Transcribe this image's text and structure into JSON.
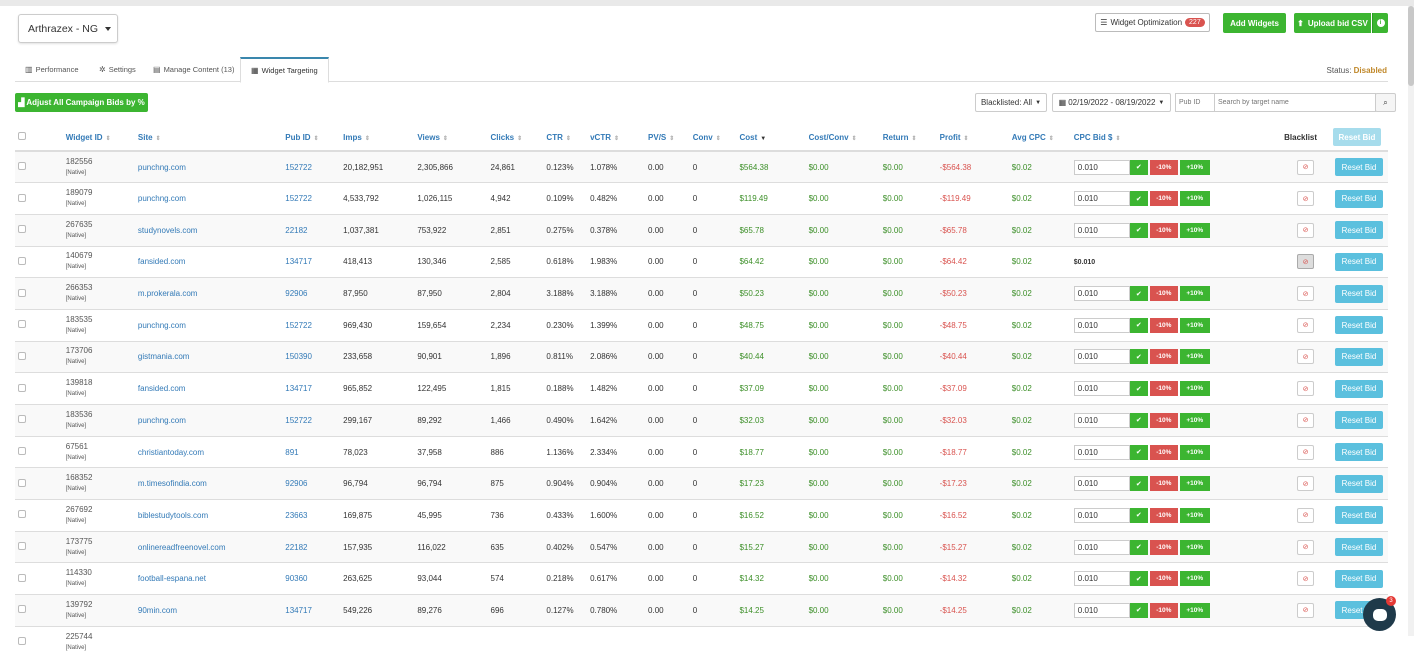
{
  "account": {
    "name": "Arthrazex - NG"
  },
  "toolbar": {
    "widget_optimization_label": "Widget Optimization",
    "widget_optimization_count": "227",
    "add_widgets_label": "Add Widgets",
    "upload_bid_csv_label": "Upload bid CSV"
  },
  "tabs": [
    {
      "label": "Performance",
      "icon": "bar-chart-icon"
    },
    {
      "label": "Settings",
      "icon": "gear-icon"
    },
    {
      "label": "Manage Content (13)",
      "icon": "file-icon"
    },
    {
      "label": "Widget Targeting",
      "icon": "grid-icon"
    }
  ],
  "status": {
    "label": "Status:",
    "value": "Disabled"
  },
  "filters": {
    "adjust_label": "Adjust All Campaign Bids by %",
    "blacklisted_label": "Blacklisted: All",
    "date_range": "02/19/2022 - 08/19/2022",
    "pub_id_placeholder": "Pub ID",
    "search_placeholder": "Search by target name"
  },
  "table": {
    "headers": [
      "Widget ID",
      "Site",
      "Pub ID",
      "Imps",
      "Views",
      "Clicks",
      "CTR",
      "vCTR",
      "PV/S",
      "Conv",
      "Cost",
      "Cost/Conv",
      "Return",
      "Profit",
      "Avg CPC",
      "CPC Bid $",
      "Blacklist"
    ],
    "reset_header_label": "Reset Bid",
    "native_tag": "[Native]",
    "minus_label": "-10%",
    "plus_label": "+10%",
    "reset_label": "Reset Bid",
    "rows": [
      {
        "wid": "182556",
        "site": "punchng.com",
        "pub": "152722",
        "imps": "20,182,951",
        "views": "2,305,866",
        "clicks": "24,861",
        "ctr": "0.123%",
        "vctr": "1.078%",
        "pvs": "0.00",
        "conv": "0",
        "cost": "$564.38",
        "cpc_conv": "$0.00",
        "ret": "$0.00",
        "profit": "-$564.38",
        "avg": "$0.02",
        "bid": "0.010",
        "fixed": false
      },
      {
        "wid": "189079",
        "site": "punchng.com",
        "pub": "152722",
        "imps": "4,533,792",
        "views": "1,026,115",
        "clicks": "4,942",
        "ctr": "0.109%",
        "vctr": "0.482%",
        "pvs": "0.00",
        "conv": "0",
        "cost": "$119.49",
        "cpc_conv": "$0.00",
        "ret": "$0.00",
        "profit": "-$119.49",
        "avg": "$0.02",
        "bid": "0.010",
        "fixed": false
      },
      {
        "wid": "267635",
        "site": "studynovels.com",
        "pub": "22182",
        "imps": "1,037,381",
        "views": "753,922",
        "clicks": "2,851",
        "ctr": "0.275%",
        "vctr": "0.378%",
        "pvs": "0.00",
        "conv": "0",
        "cost": "$65.78",
        "cpc_conv": "$0.00",
        "ret": "$0.00",
        "profit": "-$65.78",
        "avg": "$0.02",
        "bid": "0.010",
        "fixed": false
      },
      {
        "wid": "140679",
        "site": "fansided.com",
        "pub": "134717",
        "imps": "418,413",
        "views": "130,346",
        "clicks": "2,585",
        "ctr": "0.618%",
        "vctr": "1.983%",
        "pvs": "0.00",
        "conv": "0",
        "cost": "$64.42",
        "cpc_conv": "$0.00",
        "ret": "$0.00",
        "profit": "-$64.42",
        "avg": "$0.02",
        "bid": "$0.010",
        "fixed": true
      },
      {
        "wid": "266353",
        "site": "m.prokerala.com",
        "pub": "92906",
        "imps": "87,950",
        "views": "87,950",
        "clicks": "2,804",
        "ctr": "3.188%",
        "vctr": "3.188%",
        "pvs": "0.00",
        "conv": "0",
        "cost": "$50.23",
        "cpc_conv": "$0.00",
        "ret": "$0.00",
        "profit": "-$50.23",
        "avg": "$0.02",
        "bid": "0.010",
        "fixed": false
      },
      {
        "wid": "183535",
        "site": "punchng.com",
        "pub": "152722",
        "imps": "969,430",
        "views": "159,654",
        "clicks": "2,234",
        "ctr": "0.230%",
        "vctr": "1.399%",
        "pvs": "0.00",
        "conv": "0",
        "cost": "$48.75",
        "cpc_conv": "$0.00",
        "ret": "$0.00",
        "profit": "-$48.75",
        "avg": "$0.02",
        "bid": "0.010",
        "fixed": false
      },
      {
        "wid": "173706",
        "site": "gistmania.com",
        "pub": "150390",
        "imps": "233,658",
        "views": "90,901",
        "clicks": "1,896",
        "ctr": "0.811%",
        "vctr": "2.086%",
        "pvs": "0.00",
        "conv": "0",
        "cost": "$40.44",
        "cpc_conv": "$0.00",
        "ret": "$0.00",
        "profit": "-$40.44",
        "avg": "$0.02",
        "bid": "0.010",
        "fixed": false
      },
      {
        "wid": "139818",
        "site": "fansided.com",
        "pub": "134717",
        "imps": "965,852",
        "views": "122,495",
        "clicks": "1,815",
        "ctr": "0.188%",
        "vctr": "1.482%",
        "pvs": "0.00",
        "conv": "0",
        "cost": "$37.09",
        "cpc_conv": "$0.00",
        "ret": "$0.00",
        "profit": "-$37.09",
        "avg": "$0.02",
        "bid": "0.010",
        "fixed": false
      },
      {
        "wid": "183536",
        "site": "punchng.com",
        "pub": "152722",
        "imps": "299,167",
        "views": "89,292",
        "clicks": "1,466",
        "ctr": "0.490%",
        "vctr": "1.642%",
        "pvs": "0.00",
        "conv": "0",
        "cost": "$32.03",
        "cpc_conv": "$0.00",
        "ret": "$0.00",
        "profit": "-$32.03",
        "avg": "$0.02",
        "bid": "0.010",
        "fixed": false
      },
      {
        "wid": "67561",
        "site": "christiantoday.com",
        "pub": "891",
        "imps": "78,023",
        "views": "37,958",
        "clicks": "886",
        "ctr": "1.136%",
        "vctr": "2.334%",
        "pvs": "0.00",
        "conv": "0",
        "cost": "$18.77",
        "cpc_conv": "$0.00",
        "ret": "$0.00",
        "profit": "-$18.77",
        "avg": "$0.02",
        "bid": "0.010",
        "fixed": false
      },
      {
        "wid": "168352",
        "site": "m.timesofindia.com",
        "pub": "92906",
        "imps": "96,794",
        "views": "96,794",
        "clicks": "875",
        "ctr": "0.904%",
        "vctr": "0.904%",
        "pvs": "0.00",
        "conv": "0",
        "cost": "$17.23",
        "cpc_conv": "$0.00",
        "ret": "$0.00",
        "profit": "-$17.23",
        "avg": "$0.02",
        "bid": "0.010",
        "fixed": false
      },
      {
        "wid": "267692",
        "site": "biblestudytools.com",
        "pub": "23663",
        "imps": "169,875",
        "views": "45,995",
        "clicks": "736",
        "ctr": "0.433%",
        "vctr": "1.600%",
        "pvs": "0.00",
        "conv": "0",
        "cost": "$16.52",
        "cpc_conv": "$0.00",
        "ret": "$0.00",
        "profit": "-$16.52",
        "avg": "$0.02",
        "bid": "0.010",
        "fixed": false
      },
      {
        "wid": "173775",
        "site": "onlinereadfreenovel.com",
        "pub": "22182",
        "imps": "157,935",
        "views": "116,022",
        "clicks": "635",
        "ctr": "0.402%",
        "vctr": "0.547%",
        "pvs": "0.00",
        "conv": "0",
        "cost": "$15.27",
        "cpc_conv": "$0.00",
        "ret": "$0.00",
        "profit": "-$15.27",
        "avg": "$0.02",
        "bid": "0.010",
        "fixed": false
      },
      {
        "wid": "114330",
        "site": "football-espana.net",
        "pub": "90360",
        "imps": "263,625",
        "views": "93,044",
        "clicks": "574",
        "ctr": "0.218%",
        "vctr": "0.617%",
        "pvs": "0.00",
        "conv": "0",
        "cost": "$14.32",
        "cpc_conv": "$0.00",
        "ret": "$0.00",
        "profit": "-$14.32",
        "avg": "$0.02",
        "bid": "0.010",
        "fixed": false
      },
      {
        "wid": "139792",
        "site": "90min.com",
        "pub": "134717",
        "imps": "549,226",
        "views": "89,276",
        "clicks": "696",
        "ctr": "0.127%",
        "vctr": "0.780%",
        "pvs": "0.00",
        "conv": "0",
        "cost": "$14.25",
        "cpc_conv": "$0.00",
        "ret": "$0.00",
        "profit": "-$14.25",
        "avg": "$0.02",
        "bid": "0.010",
        "fixed": false
      },
      {
        "wid": "225744",
        "site": "",
        "pub": "",
        "imps": "",
        "views": "",
        "clicks": "",
        "ctr": "",
        "vctr": "",
        "pvs": "",
        "conv": "",
        "cost": "",
        "cpc_conv": "",
        "ret": "",
        "profit": "",
        "avg": "",
        "bid": "",
        "fixed": false
      }
    ]
  },
  "chat": {
    "unread": "3"
  },
  "colors": {
    "green": "#3cb531",
    "red": "#d9534f",
    "link": "#337ab7",
    "reset": "#5bc0de"
  }
}
